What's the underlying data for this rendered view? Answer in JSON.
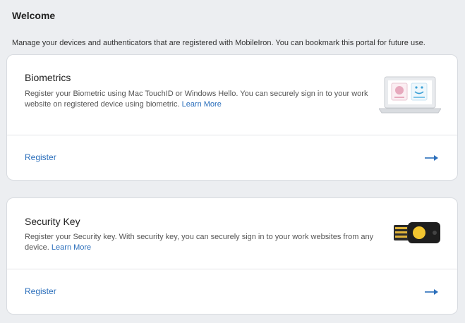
{
  "header": {
    "title": "Welcome",
    "subtitle": "Manage your devices and authenticators that are registered with MobileIron. You can bookmark this portal for future use."
  },
  "cards": [
    {
      "title": "Biometrics",
      "description": "Register your Biometric using Mac TouchID or Windows Hello. You can securely sign in to your work website on registered device using biometric.",
      "learn_more": "Learn More",
      "register_label": "Register",
      "illustration": "laptop-biometric-icon",
      "arrow_icon": "arrow-right-icon"
    },
    {
      "title": "Security Key",
      "description": "Register your Security key. With security key, you can securely sign in to your work websites from any device.",
      "learn_more": "Learn More",
      "register_label": "Register",
      "illustration": "usb-security-key-icon",
      "arrow_icon": "arrow-right-icon"
    }
  ],
  "colors": {
    "accent": "#2a6ebb",
    "background": "#eceef1",
    "key_gold": "#f2c530"
  }
}
